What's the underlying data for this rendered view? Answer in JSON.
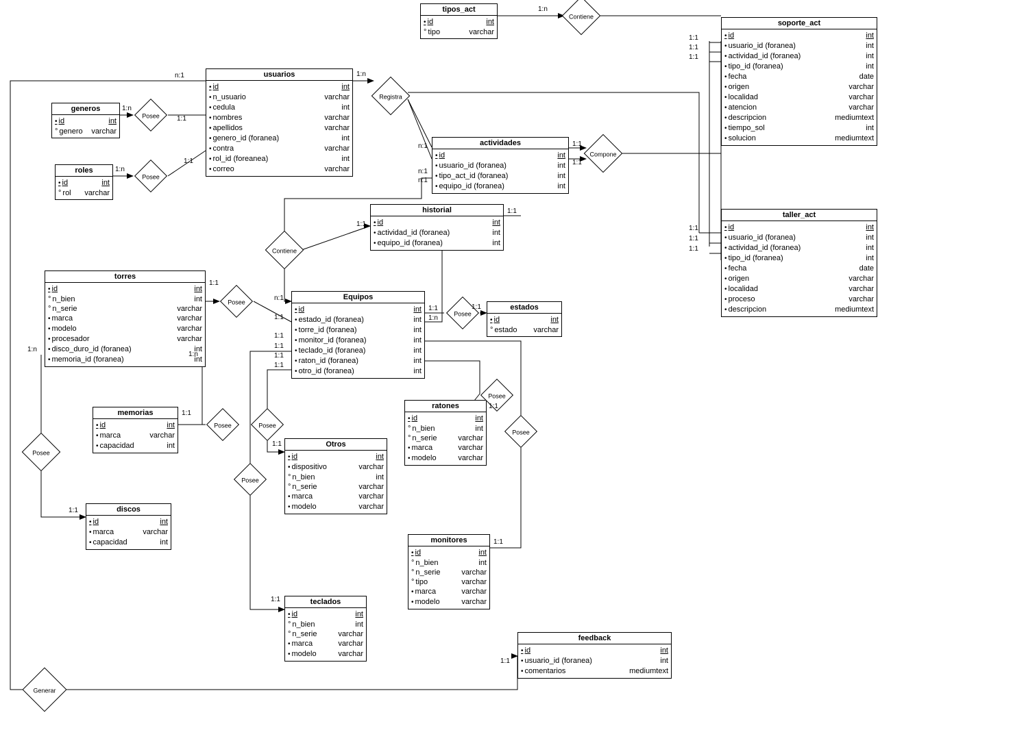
{
  "entities": {
    "tipos_act": {
      "title": "tipos_act",
      "rows": [
        {
          "name": "id",
          "type": "int",
          "pk": true,
          "marker": "bullet"
        },
        {
          "name": "tipo",
          "type": "varchar",
          "marker": "circle"
        }
      ]
    },
    "soporte_act": {
      "title": "soporte_act",
      "rows": [
        {
          "name": "id",
          "type": "int",
          "pk": true,
          "marker": "bullet"
        },
        {
          "name": "usuario_id (foranea)",
          "type": "int",
          "marker": "bullet"
        },
        {
          "name": "actividad_id (foranea)",
          "type": "int",
          "marker": "bullet"
        },
        {
          "name": "tipo_id (foranea)",
          "type": "int",
          "marker": "bullet"
        },
        {
          "name": "fecha",
          "type": "date",
          "marker": "bullet"
        },
        {
          "name": "origen",
          "type": "varchar",
          "marker": "bullet"
        },
        {
          "name": "localidad",
          "type": "varchar",
          "marker": "bullet"
        },
        {
          "name": "atencion",
          "type": "varchar",
          "marker": "bullet"
        },
        {
          "name": "descripcion",
          "type": "mediumtext",
          "marker": "bullet"
        },
        {
          "name": "tiempo_sol",
          "type": "int",
          "marker": "bullet"
        },
        {
          "name": "solucion",
          "type": "mediumtext",
          "marker": "bullet"
        }
      ]
    },
    "usuarios": {
      "title": "usuarios",
      "rows": [
        {
          "name": "id",
          "type": "int",
          "pk": true,
          "marker": "bullet"
        },
        {
          "name": "n_usuario",
          "type": "varchar",
          "marker": "bullet"
        },
        {
          "name": "cedula",
          "type": "int",
          "marker": "bullet"
        },
        {
          "name": "nombres",
          "type": "varchar",
          "marker": "bullet"
        },
        {
          "name": "apellidos",
          "type": "varchar",
          "marker": "bullet"
        },
        {
          "name": "genero_id (foranea)",
          "type": "int",
          "marker": "bullet"
        },
        {
          "name": "contra",
          "type": "varchar",
          "marker": "bullet"
        },
        {
          "name": "rol_id (foreanea)",
          "type": "int",
          "marker": "bullet"
        },
        {
          "name": "correo",
          "type": "varchar",
          "marker": "bullet"
        }
      ]
    },
    "generos": {
      "title": "generos",
      "rows": [
        {
          "name": "id",
          "type": "int",
          "pk": true,
          "marker": "bullet"
        },
        {
          "name": "genero",
          "type": "varchar",
          "marker": "circle"
        }
      ]
    },
    "roles": {
      "title": "roles",
      "rows": [
        {
          "name": "id",
          "type": "int",
          "pk": true,
          "marker": "bullet"
        },
        {
          "name": "rol",
          "type": "varchar",
          "marker": "circle"
        }
      ]
    },
    "actividades": {
      "title": "actividades",
      "rows": [
        {
          "name": "id",
          "type": "int",
          "pk": true,
          "marker": "bullet"
        },
        {
          "name": "usuario_id (foranea)",
          "type": "int",
          "marker": "bullet"
        },
        {
          "name": "tipo_act_id (foranea)",
          "type": "int",
          "marker": "bullet"
        },
        {
          "name": "equipo_id (foranea)",
          "type": "int",
          "marker": "bullet"
        }
      ]
    },
    "taller_act": {
      "title": "taller_act",
      "rows": [
        {
          "name": "id",
          "type": "int",
          "pk": true,
          "marker": "bullet"
        },
        {
          "name": "usuario_id (foranea)",
          "type": "int",
          "marker": "bullet"
        },
        {
          "name": "actividad_id (foranea)",
          "type": "int",
          "marker": "bullet"
        },
        {
          "name": "tipo_id (foranea)",
          "type": "int",
          "marker": "bullet"
        },
        {
          "name": "fecha",
          "type": "date",
          "marker": "bullet"
        },
        {
          "name": "origen",
          "type": "varchar",
          "marker": "bullet"
        },
        {
          "name": "localidad",
          "type": "varchar",
          "marker": "bullet"
        },
        {
          "name": "proceso",
          "type": "varchar",
          "marker": "bullet"
        },
        {
          "name": "descripcion",
          "type": "mediumtext",
          "marker": "bullet"
        }
      ]
    },
    "historial": {
      "title": "historial",
      "rows": [
        {
          "name": "id",
          "type": "int",
          "pk": true,
          "marker": "bullet"
        },
        {
          "name": "actividad_id (foranea)",
          "type": "int",
          "marker": "bullet"
        },
        {
          "name": "equipo_id (foranea)",
          "type": "int",
          "marker": "bullet"
        }
      ]
    },
    "torres": {
      "title": "torres",
      "rows": [
        {
          "name": "id",
          "type": "int",
          "pk": true,
          "marker": "bullet"
        },
        {
          "name": "n_bien",
          "type": "int",
          "marker": "circle"
        },
        {
          "name": "n_serie",
          "type": "varchar",
          "marker": "circle"
        },
        {
          "name": "marca",
          "type": "varchar",
          "marker": "bullet"
        },
        {
          "name": "modelo",
          "type": "varchar",
          "marker": "bullet"
        },
        {
          "name": "procesador",
          "type": "varchar",
          "marker": "bullet"
        },
        {
          "name": "disco_duro_id (foranea)",
          "type": "int",
          "marker": "bullet"
        },
        {
          "name": "memoria_id (foranea)",
          "type": "int",
          "marker": "bullet"
        }
      ]
    },
    "equipos": {
      "title": "Equipos",
      "rows": [
        {
          "name": "id",
          "type": "int",
          "pk": true,
          "marker": "bullet"
        },
        {
          "name": "estado_id (foranea)",
          "type": "int",
          "marker": "bullet"
        },
        {
          "name": "torre_id (foranea)",
          "type": "int",
          "marker": "bullet"
        },
        {
          "name": "monitor_id (foranea)",
          "type": "int",
          "marker": "bullet"
        },
        {
          "name": "teclado_id (foranea)",
          "type": "int",
          "marker": "bullet"
        },
        {
          "name": "raton_id (foranea)",
          "type": "int",
          "marker": "bullet"
        },
        {
          "name": "otro_id (foranea)",
          "type": "int",
          "marker": "bullet"
        }
      ]
    },
    "estados": {
      "title": "estados",
      "rows": [
        {
          "name": "id",
          "type": "int",
          "pk": true,
          "marker": "bullet"
        },
        {
          "name": "estado",
          "type": "varchar",
          "marker": "circle"
        }
      ]
    },
    "memorias": {
      "title": "memorias",
      "rows": [
        {
          "name": "id",
          "type": "int",
          "pk": true,
          "marker": "bullet"
        },
        {
          "name": "marca",
          "type": "varchar",
          "marker": "bullet"
        },
        {
          "name": "capacidad",
          "type": "int",
          "marker": "bullet"
        }
      ]
    },
    "discos": {
      "title": "discos",
      "rows": [
        {
          "name": "id",
          "type": "int",
          "pk": true,
          "marker": "bullet"
        },
        {
          "name": "marca",
          "type": "varchar",
          "marker": "bullet"
        },
        {
          "name": "capacidad",
          "type": "int",
          "marker": "bullet"
        }
      ]
    },
    "otros": {
      "title": "Otros",
      "rows": [
        {
          "name": "id",
          "type": "int",
          "pk": true,
          "marker": "bullet"
        },
        {
          "name": "dispositivo",
          "type": "varchar",
          "marker": "bullet"
        },
        {
          "name": "n_bien",
          "type": "int",
          "marker": "circle"
        },
        {
          "name": "n_serie",
          "type": "varchar",
          "marker": "circle"
        },
        {
          "name": "marca",
          "type": "varchar",
          "marker": "bullet"
        },
        {
          "name": "modelo",
          "type": "varchar",
          "marker": "bullet"
        }
      ]
    },
    "ratones": {
      "title": "ratones",
      "rows": [
        {
          "name": "id",
          "type": "int",
          "pk": true,
          "marker": "bullet"
        },
        {
          "name": "n_bien",
          "type": "int",
          "marker": "circle"
        },
        {
          "name": "n_serie",
          "type": "varchar",
          "marker": "circle"
        },
        {
          "name": "marca",
          "type": "varchar",
          "marker": "bullet"
        },
        {
          "name": "modelo",
          "type": "varchar",
          "marker": "bullet"
        }
      ]
    },
    "monitores": {
      "title": "monitores",
      "rows": [
        {
          "name": "id",
          "type": "int",
          "pk": true,
          "marker": "bullet"
        },
        {
          "name": "n_bien",
          "type": "int",
          "marker": "circle"
        },
        {
          "name": "n_serie",
          "type": "varchar",
          "marker": "circle"
        },
        {
          "name": "tipo",
          "type": "varchar",
          "marker": "circle"
        },
        {
          "name": "marca",
          "type": "varchar",
          "marker": "bullet"
        },
        {
          "name": "modelo",
          "type": "varchar",
          "marker": "bullet"
        }
      ]
    },
    "teclados": {
      "title": "teclados",
      "rows": [
        {
          "name": "id",
          "type": "int",
          "pk": true,
          "marker": "bullet"
        },
        {
          "name": "n_bien",
          "type": "int",
          "marker": "circle"
        },
        {
          "name": "n_serie",
          "type": "varchar",
          "marker": "circle"
        },
        {
          "name": "marca",
          "type": "varchar",
          "marker": "bullet"
        },
        {
          "name": "modelo",
          "type": "varchar",
          "marker": "bullet"
        }
      ]
    },
    "feedback": {
      "title": "feedback",
      "rows": [
        {
          "name": "id",
          "type": "int",
          "pk": true,
          "marker": "bullet"
        },
        {
          "name": "usuario_id (foranea)",
          "type": "int",
          "marker": "bullet"
        },
        {
          "name": "comentarios",
          "type": "mediumtext",
          "marker": "bullet"
        }
      ]
    }
  },
  "relationships": {
    "contiene1": "Contiene",
    "registra": "Registra",
    "compone": "Compone",
    "contiene2": "Contiene",
    "posee_gen": "Posee",
    "posee_rol": "Posee",
    "posee_torre": "Posee",
    "posee_estado": "Posee",
    "posee_mem": "Posee",
    "posee_disco": "Posee",
    "posee_otros": "Posee",
    "posee_raton": "Posee",
    "posee_monitor": "Posee",
    "posee_teclado": "Posee",
    "generar": "Generar"
  },
  "cards": {
    "n1": "n:1",
    "1n": "1:n",
    "11": "1:1"
  }
}
